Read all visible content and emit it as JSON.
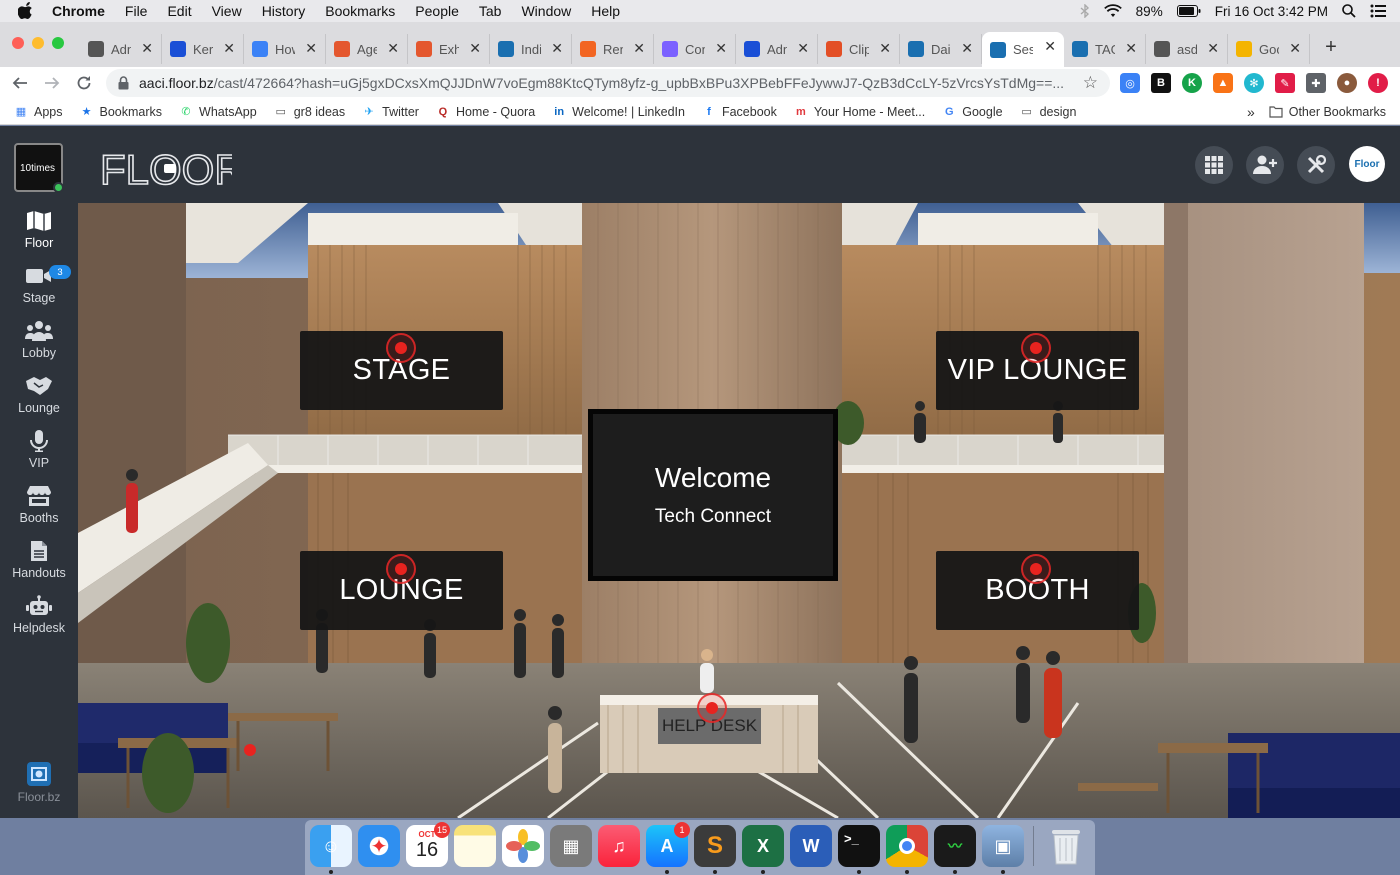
{
  "menubar": {
    "app": "Chrome",
    "items": [
      "File",
      "Edit",
      "View",
      "History",
      "Bookmarks",
      "People",
      "Tab",
      "Window",
      "Help"
    ],
    "battery": "89%",
    "datetime": "Fri 16 Oct  3:42 PM"
  },
  "tabs": [
    {
      "title": "Adn",
      "color": "#555555",
      "icon": "globe-icon"
    },
    {
      "title": "Ker",
      "color": "#1a4fd6",
      "icon": "a-icon"
    },
    {
      "title": "How",
      "color": "#3b82f6",
      "icon": "q-icon"
    },
    {
      "title": "Age",
      "color": "#e4572e",
      "icon": "10-icon"
    },
    {
      "title": "Exh",
      "color": "#e4572e",
      "icon": "10-icon"
    },
    {
      "title": "Indi",
      "color": "#1a6fb0",
      "icon": "floor-icon"
    },
    {
      "title": "Ren",
      "color": "#f26522",
      "icon": "square-icon"
    },
    {
      "title": "Con",
      "color": "#7b61ff",
      "icon": "drive-icon"
    },
    {
      "title": "Adn",
      "color": "#1a4fd6",
      "icon": "a-icon"
    },
    {
      "title": "Clip",
      "color": "#e34f26",
      "icon": "html5-icon"
    },
    {
      "title": "Dail",
      "color": "#1a6fb0",
      "icon": "floor-icon"
    },
    {
      "title": "Ses",
      "color": "#1a6fb0",
      "icon": "floor-icon",
      "active": true
    },
    {
      "title": "TAG",
      "color": "#1a6fb0",
      "icon": "floor-icon"
    },
    {
      "title": "asd",
      "color": "#555555",
      "icon": "globe-icon"
    },
    {
      "title": "Goo",
      "color": "#f4b400",
      "icon": "slides-icon"
    }
  ],
  "toolbar": {
    "url_host": "aaci.floor.bz",
    "url_path": "/cast/472664?hash=uGj5gxDCxsXmQJJDnW7voEgm88KtcQTym8yfz-g_upbBxBPu3XPBebFFeJywwJ7-QzB3dCcLY-5zVrcsYsTdMg==..."
  },
  "bookmarks": {
    "items": [
      {
        "label": "Apps",
        "icon": "apps-grid-icon"
      },
      {
        "label": "Bookmarks",
        "icon": "star-icon"
      },
      {
        "label": "WhatsApp",
        "icon": "whatsapp-icon"
      },
      {
        "label": "gr8 ideas",
        "icon": "folder-icon"
      },
      {
        "label": "Twitter",
        "icon": "twitter-icon"
      },
      {
        "label": "Home - Quora",
        "icon": "quora-icon"
      },
      {
        "label": "Welcome! | LinkedIn",
        "icon": "linkedin-icon"
      },
      {
        "label": "Facebook",
        "icon": "facebook-icon"
      },
      {
        "label": "Your Home - Meet...",
        "icon": "meetup-icon"
      },
      {
        "label": "Google",
        "icon": "google-icon"
      },
      {
        "label": "design",
        "icon": "folder-icon"
      }
    ],
    "overflow": "»",
    "other": "Other Bookmarks"
  },
  "app": {
    "org_logo_text": "10times",
    "brand": "FLOOR",
    "avatar_text": "Floor"
  },
  "sidebar": {
    "items": [
      {
        "label": "Floor",
        "icon": "map-icon",
        "active": true
      },
      {
        "label": "Stage",
        "icon": "video-camera-icon",
        "badge": "3"
      },
      {
        "label": "Lobby",
        "icon": "people-group-icon"
      },
      {
        "label": "Lounge",
        "icon": "handshake-icon"
      },
      {
        "label": "VIP",
        "icon": "microphone-icon"
      },
      {
        "label": "Booths",
        "icon": "store-icon"
      },
      {
        "label": "Handouts",
        "icon": "document-icon"
      },
      {
        "label": "Helpdesk",
        "icon": "robot-icon"
      }
    ],
    "footer": "Floor.bz"
  },
  "scene": {
    "signs": {
      "stage": "STAGE",
      "vip_lounge": "VIP LOUNGE",
      "lounge": "LOUNGE",
      "booth": "BOOTH"
    },
    "welcome": {
      "title": "Welcome",
      "subtitle": "Tech Connect"
    },
    "help_desk": "HELP DESK"
  },
  "dock": {
    "calendar_month": "OCT",
    "calendar_day": "16",
    "calendar_badge": "15",
    "appstore_badge": "1"
  }
}
